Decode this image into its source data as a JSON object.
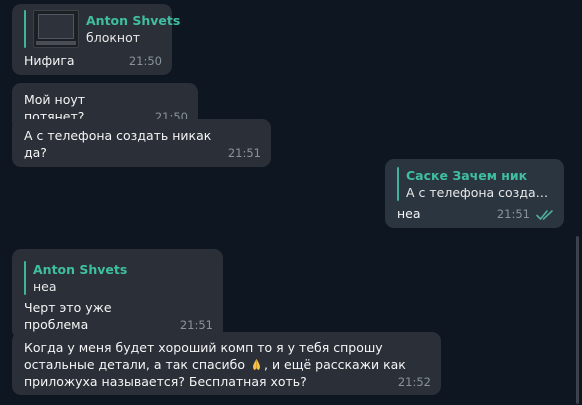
{
  "messages": [
    {
      "reply_author": "Anton Shvets",
      "reply_text": "блокнот",
      "reply_thumb": "laptop-thumbnail",
      "text": "Нифига",
      "time": "21:50"
    },
    {
      "text": "Мой ноут потянет?",
      "time": "21:50"
    },
    {
      "text": "А с телефона создать никак да?",
      "time": "21:51"
    },
    {
      "reply_author": "Саске Зачем ник",
      "reply_text": "А с телефона создать ...",
      "text": "неа",
      "time": "21:51",
      "status_icon": "double-check-icon"
    },
    {
      "reply_author": "Anton Shvets",
      "reply_text": "неа",
      "text": "Черт это уже проблема",
      "time": "21:51"
    },
    {
      "text_line1": "Когда у меня будет хороший комп то я у тебя спрошу",
      "text_line2_a": "остальные детали, а так спасибо ",
      "emoji": "folded-hands-emoji",
      "text_line2_b": ", и ещё расскажи как",
      "text_line3": "приложуха называется? Бесплатная хоть?",
      "time": "21:52"
    }
  ],
  "colors": {
    "background": "#0e1621",
    "bubble_in": "#2a2f38",
    "bubble_out": "#2b3540",
    "reply_accent": "#3fbf9f",
    "time": "#8a929b",
    "check": "#4fae9b"
  }
}
